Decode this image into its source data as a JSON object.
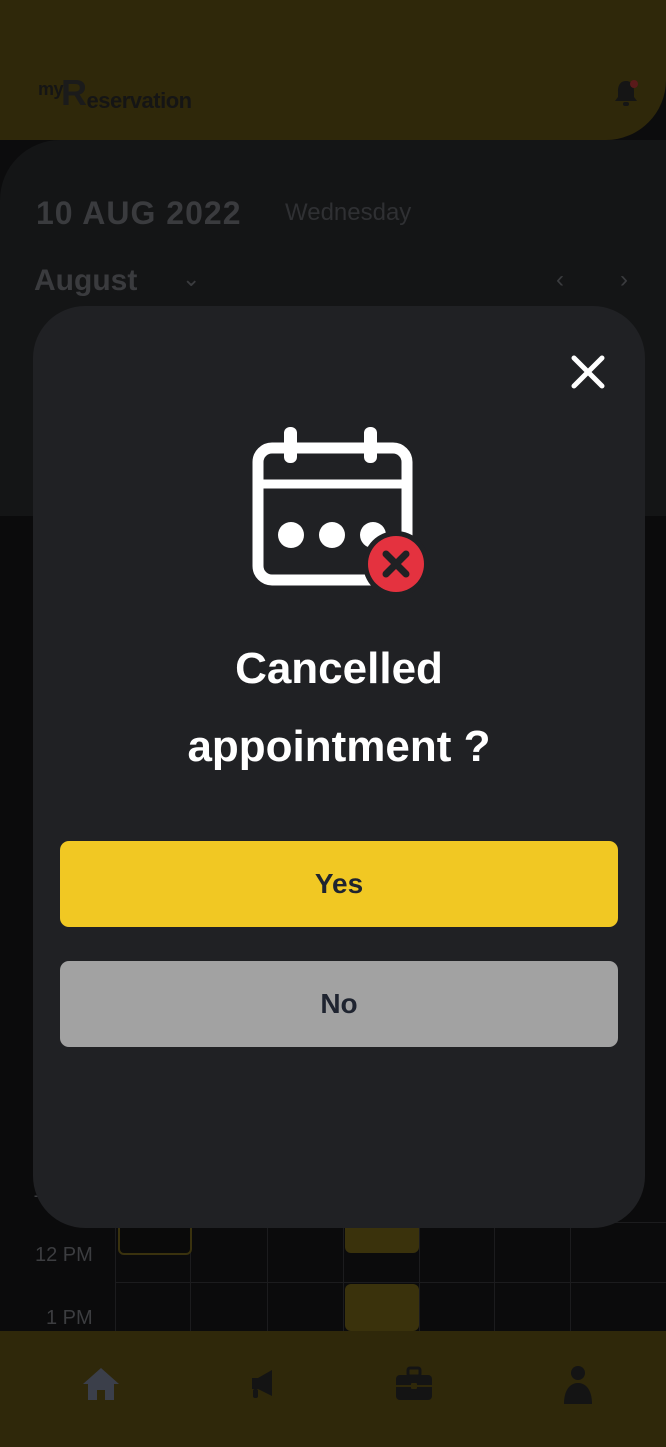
{
  "header": {
    "logo_prefix": "my",
    "logo_letter": "R",
    "logo_rest": "eservation"
  },
  "date_bar": {
    "date": "10 AUG 2022",
    "weekday": "Wednesday",
    "month": "August",
    "month_chevron": "⌄",
    "prev": "‹",
    "next": "›"
  },
  "schedule": {
    "time_labels": [
      "1",
      "12 PM",
      "1 PM"
    ]
  },
  "modal": {
    "title_line1": "Cancelled",
    "title_line2": "appointment ?",
    "yes_label": "Yes",
    "no_label": "No",
    "icon": "calendar-cancel-icon",
    "close_icon": "close-icon"
  },
  "bottom_nav": {
    "items": [
      "home-icon",
      "megaphone-icon",
      "briefcase-icon",
      "user-icon"
    ]
  },
  "colors": {
    "accent": "#f1c823",
    "modal_bg": "#202124",
    "cancel_red": "#e4323f",
    "no_button": "#a2a2a2"
  }
}
